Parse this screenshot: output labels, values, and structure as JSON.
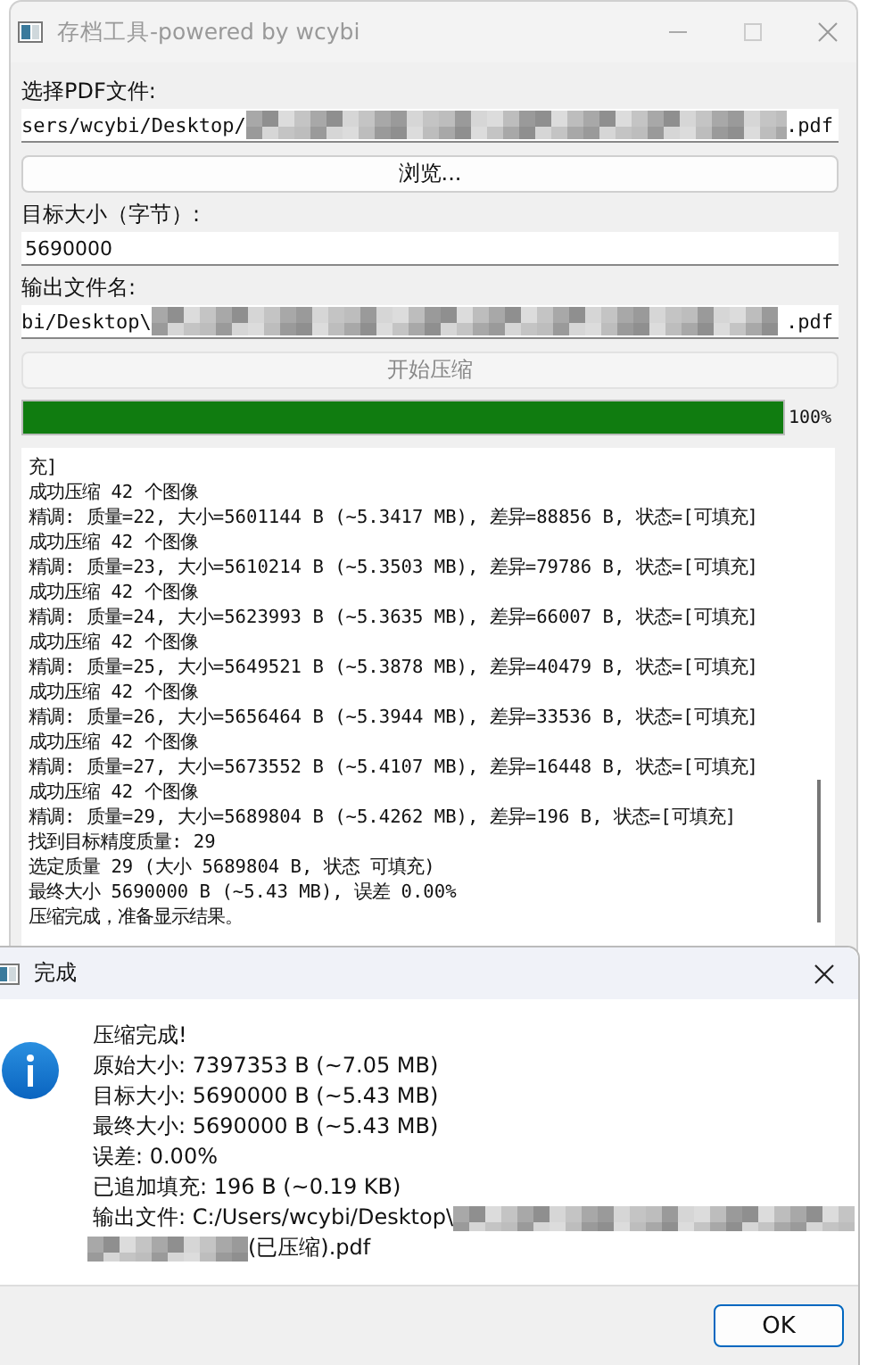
{
  "window": {
    "title": "存档工具-powered by wcybi"
  },
  "form": {
    "pdf_label": "选择PDF文件:",
    "pdf_path": {
      "prefix": "sers/wcybi/Desktop/",
      "suffix": ".pdf"
    },
    "browse_button": "浏览...",
    "target_label": "目标大小（字节）:",
    "target_value": "5690000",
    "output_label": "输出文件名:",
    "output_path": {
      "prefix": "bi/Desktop\\",
      "suffix": ".pdf"
    },
    "start_button": {
      "label": "开始压缩",
      "disabled": true
    }
  },
  "progress": {
    "level": 1,
    "reading": "100%"
  },
  "log": [
    "充]",
    "成功压缩 42 个图像",
    "精调: 质量=22, 大小=5601144 B (~5.3417 MB), 差异=88856 B, 状态=[可填充]",
    "成功压缩 42 个图像",
    "精调: 质量=23, 大小=5610214 B (~5.3503 MB), 差异=79786 B, 状态=[可填充]",
    "成功压缩 42 个图像",
    "精调: 质量=24, 大小=5623993 B (~5.3635 MB), 差异=66007 B, 状态=[可填充]",
    "成功压缩 42 个图像",
    "精调: 质量=25, 大小=5649521 B (~5.3878 MB), 差异=40479 B, 状态=[可填充]",
    "成功压缩 42 个图像",
    "精调: 质量=26, 大小=5656464 B (~5.3944 MB), 差异=33536 B, 状态=[可填充]",
    "成功压缩 42 个图像",
    "精调: 质量=27, 大小=5673552 B (~5.4107 MB), 差异=16448 B, 状态=[可填充]",
    "成功压缩 42 个图像",
    "精调: 质量=29, 大小=5689804 B (~5.4262 MB), 差异=196 B, 状态=[可填充]",
    "找到目标精度质量: 29",
    "选定质量 29 (大小 5689804 B, 状态 可填充)",
    "最终大小 5690000 B (~5.43 MB), 误差 0.00%",
    "压缩完成，准备显示结果。"
  ],
  "dialog": {
    "title": "完成",
    "lines": [
      "压缩完成!",
      "原始大小: 7397353 B (~7.05 MB)",
      "目标大小: 5690000 B (~5.43 MB)",
      "最终大小: 5690000 B (~5.43 MB)",
      "误差: 0.00%",
      "已追加填充: 196 B (~0.19 KB)"
    ],
    "output_file": {
      "prefix": "输出文件: C:/Users/wcybi/Desktop\\",
      "suffix": "(已压缩).pdf"
    },
    "ok_button": "OK"
  }
}
